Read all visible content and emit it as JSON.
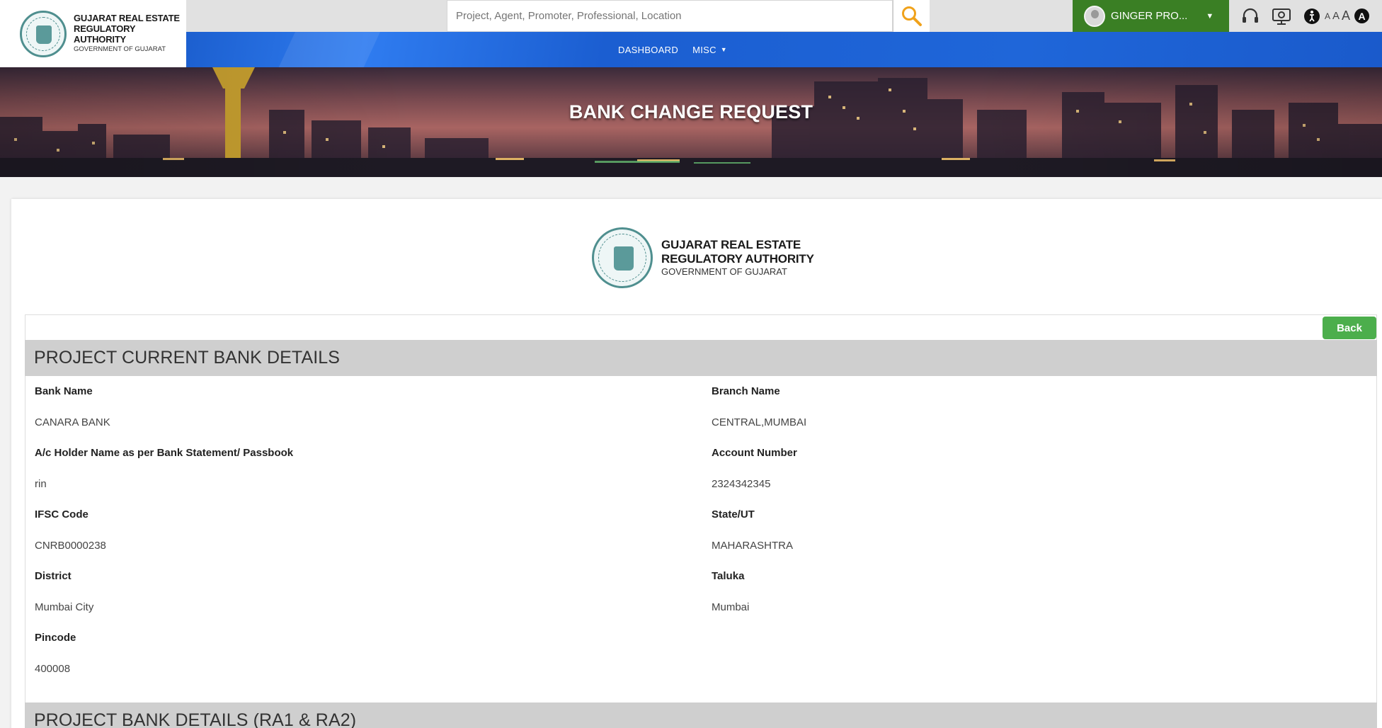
{
  "brand": {
    "line1": "GUJARAT REAL ESTATE",
    "line2": "REGULATORY AUTHORITY",
    "line3": "GOVERNMENT OF GUJARAT"
  },
  "search": {
    "placeholder": "Project, Agent, Promoter, Professional, Location"
  },
  "user": {
    "name": "GINGER PRO..."
  },
  "font_size_options": [
    "A",
    "A",
    "A",
    "A"
  ],
  "nav": {
    "dashboard": "DASHBOARD",
    "misc": "MISC"
  },
  "banner": {
    "title": "BANK CHANGE REQUEST"
  },
  "card_logo": {
    "line1": "GUJARAT REAL ESTATE",
    "line2": "REGULATORY AUTHORITY",
    "line3": "GOVERNMENT OF GUJARAT"
  },
  "back_label": "Back",
  "current_bank": {
    "heading": "PROJECT CURRENT BANK DETAILS",
    "fields": [
      {
        "label": "Bank Name",
        "value": "CANARA BANK"
      },
      {
        "label": "Branch Name",
        "value": "CENTRAL,MUMBAI"
      },
      {
        "label": "A/c Holder Name as per Bank Statement/ Passbook",
        "value": "rin"
      },
      {
        "label": "Account Number",
        "value": "2324342345"
      },
      {
        "label": "IFSC Code",
        "value": "CNRB0000238"
      },
      {
        "label": "State/UT",
        "value": "MAHARASHTRA"
      },
      {
        "label": "District",
        "value": "Mumbai City"
      },
      {
        "label": "Taluka",
        "value": "Mumbai"
      },
      {
        "label": "Pincode",
        "value": "400008"
      }
    ]
  },
  "ra_bank": {
    "heading": "PROJECT BANK DETAILS (RA1 & RA2)"
  }
}
